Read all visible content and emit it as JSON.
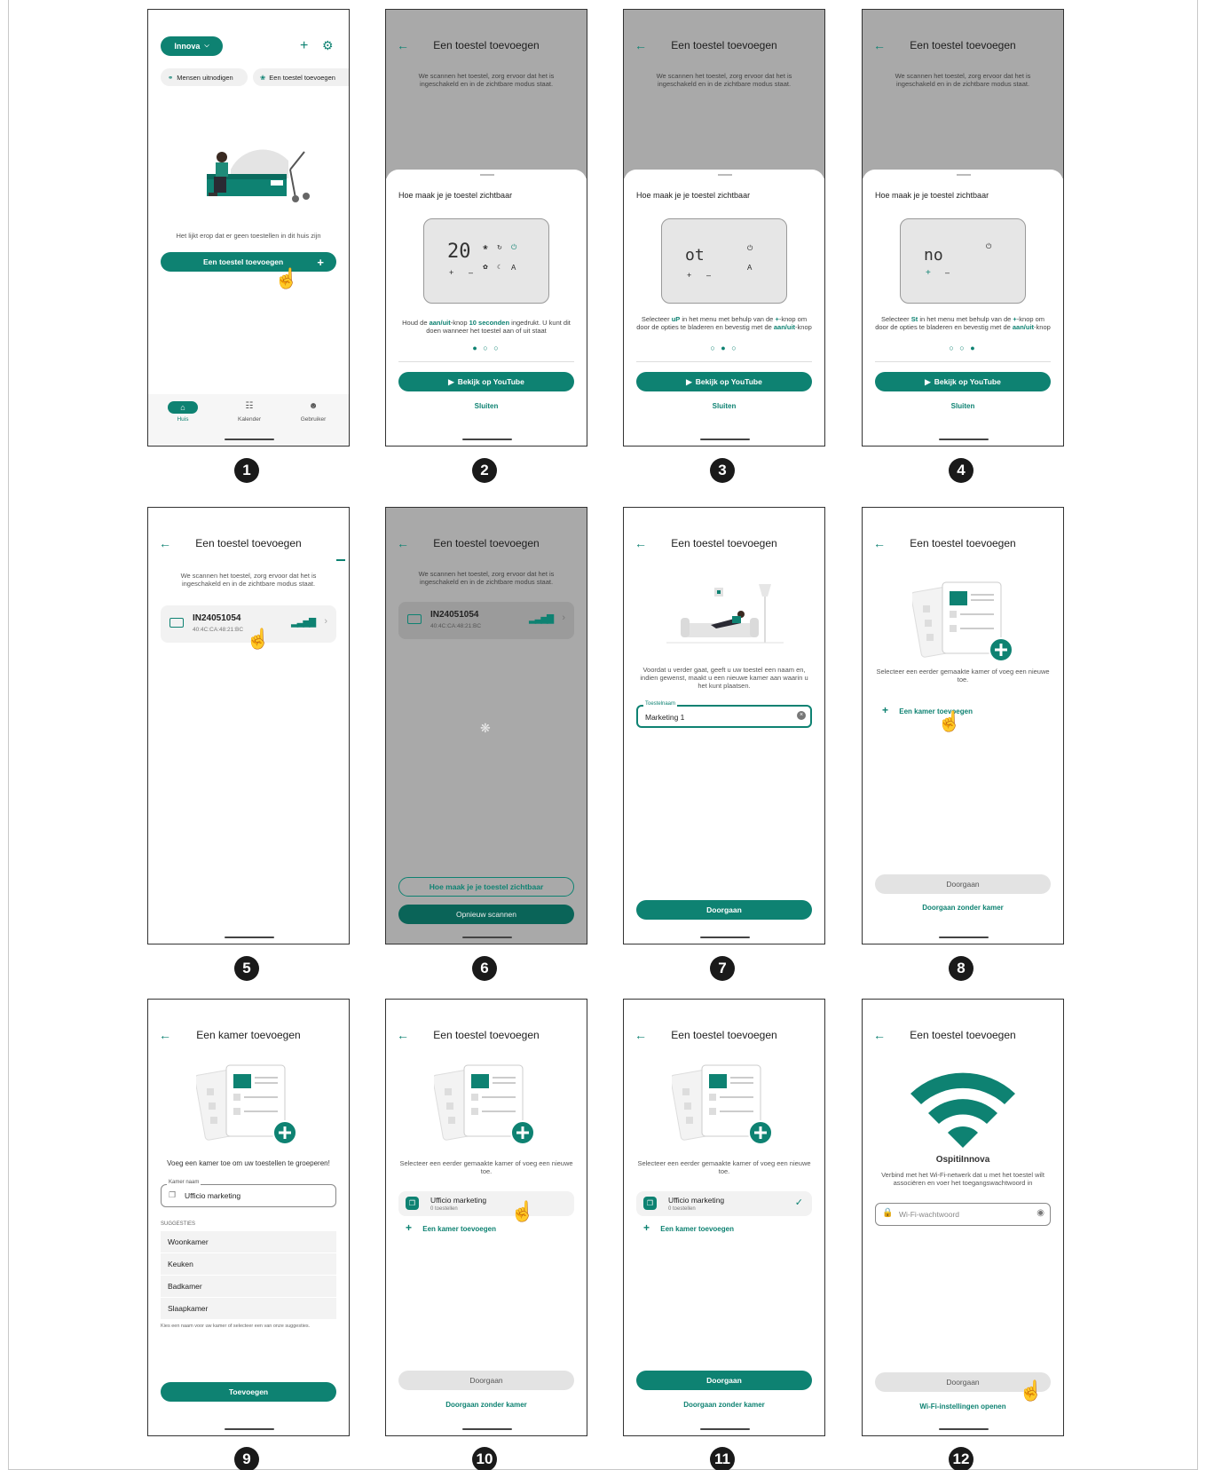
{
  "steps": [
    "1",
    "2",
    "3",
    "4",
    "5",
    "6",
    "7",
    "8",
    "9",
    "10",
    "11",
    "12"
  ],
  "common": {
    "add_device_title": "Een toestel toevoegen",
    "scan_text": "We scannen het toestel, zorg ervoor dat het is ingeschakeld en in de zichtbare modus staat.",
    "sheet_heading": "Hoe maak je je toestel zichtbaar",
    "youtube": "Bekijk op YouTube",
    "close": "Sluiten",
    "continue": "Doorgaan",
    "continue_no_room": "Doorgaan zonder kamer",
    "select_room_text": "Selecteer een eerder gemaakte kamer of voeg een nieuwe toe.",
    "add_room": "Een kamer toevoegen"
  },
  "s1": {
    "home_name": "Innova",
    "invite": "Mensen uitnodigen",
    "add_device_chip": "Een toestel toevoegen",
    "empty_text": "Het lijkt erop dat er geen toestellen in dit huis zijn",
    "add_button": "Een toestel toevoegen",
    "nav": [
      "Huis",
      "Kalender",
      "Gebruiker"
    ]
  },
  "s2": {
    "display": "20",
    "text_a": "Houd de ",
    "text_b": "aan/uit",
    "text_c": "-knop ",
    "text_d": "10 seconden",
    "text_e": " ingedrukt. U kunt dit doen wanneer het toestel aan of uit staat",
    "dots": "● ○ ○"
  },
  "s3": {
    "display": "ot",
    "text_a": "Selecteer ",
    "text_b": "uP",
    "text_c": " in het menu met behulp van de ",
    "text_d": "+",
    "text_e": "-knop om door de opties te bladeren en bevestig met de ",
    "text_f": "aan/uit",
    "text_g": "-knop",
    "dots": "○ ● ○"
  },
  "s4": {
    "display": "no",
    "text_a": "Selecteer ",
    "text_b": "St",
    "text_c": " in het menu met behulp van de ",
    "text_d": "+",
    "text_e": "-knop om door de opties te bladeren en bevestig met de ",
    "text_f": "aan/uit",
    "text_g": "-knop",
    "dots": "○ ○ ●"
  },
  "device": {
    "name": "IN24051054",
    "mac": "40:4C:CA:48:21:BC"
  },
  "s6": {
    "how_visible": "Hoe maak je je toestel zichtbaar",
    "rescan": "Opnieuw scannen"
  },
  "s7": {
    "text": "Voordat u verder gaat, geeft u uw toestel een naam en, indien gewenst, maakt u een nieuwe kamer aan waarin u het kunt plaatsen.",
    "field_label": "Toestelnaam",
    "field_value": "Marketing 1"
  },
  "s9": {
    "title": "Een kamer toevoegen",
    "text": "Voeg een kamer toe om uw toestellen te groeperen!",
    "field_label": "Kamer naam",
    "field_value": "Ufficio marketing",
    "suggestions_label": "SUGGESTIES",
    "suggestions": [
      "Woonkamer",
      "Keuken",
      "Badkamer",
      "Slaapkamer"
    ],
    "hint": "Kies een naam voor uw kamer of selecteer een van onze suggesties.",
    "button": "Toevoegen"
  },
  "room": {
    "name": "Ufficio marketing",
    "count": "0 toestellen"
  },
  "s12": {
    "network": "OspitiInnova",
    "text": "Verbind met het Wi-Fi-netwerk dat u met het toestel wilt associëren en voer het toegangswachtwoord in",
    "placeholder": "Wi-Fi-wachtwoord",
    "settings_link": "Wi-Fi-instellingen openen"
  },
  "colors": {
    "accent": "#0e8272",
    "grey_overlay": "#a9a9a9"
  }
}
